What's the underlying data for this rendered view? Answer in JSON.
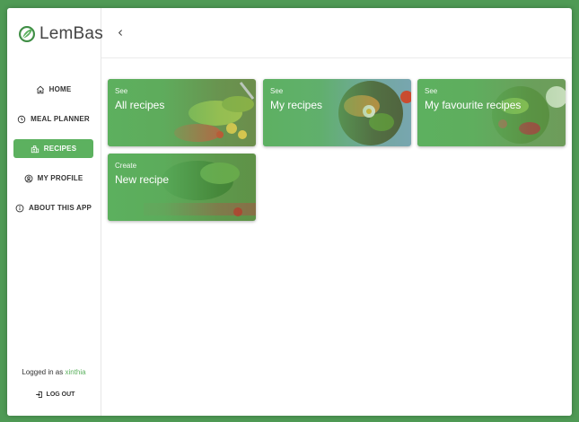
{
  "app": {
    "name": "LemBas",
    "accent": "#5cb15f"
  },
  "sidebar": {
    "items": [
      {
        "label": "HOME",
        "icon": "home-icon",
        "active": false
      },
      {
        "label": "MEAL PLANNER",
        "icon": "clock-icon",
        "active": false
      },
      {
        "label": "RECIPES",
        "icon": "recipes-icon",
        "active": true
      },
      {
        "label": "MY PROFILE",
        "icon": "account-circle-icon",
        "active": false
      },
      {
        "label": "ABOUT THIS APP",
        "icon": "info-icon",
        "active": false
      }
    ],
    "logged_in_prefix": "Logged in as",
    "username": "xinthia",
    "logout_label": "LOG OUT"
  },
  "topbar": {
    "back_icon": "chevron-left-icon"
  },
  "cards": [
    {
      "kicker": "See",
      "title": "All recipes"
    },
    {
      "kicker": "See",
      "title": "My recipes"
    },
    {
      "kicker": "See",
      "title": "My favourite recipes"
    },
    {
      "kicker": "Create",
      "title": "New recipe"
    }
  ]
}
